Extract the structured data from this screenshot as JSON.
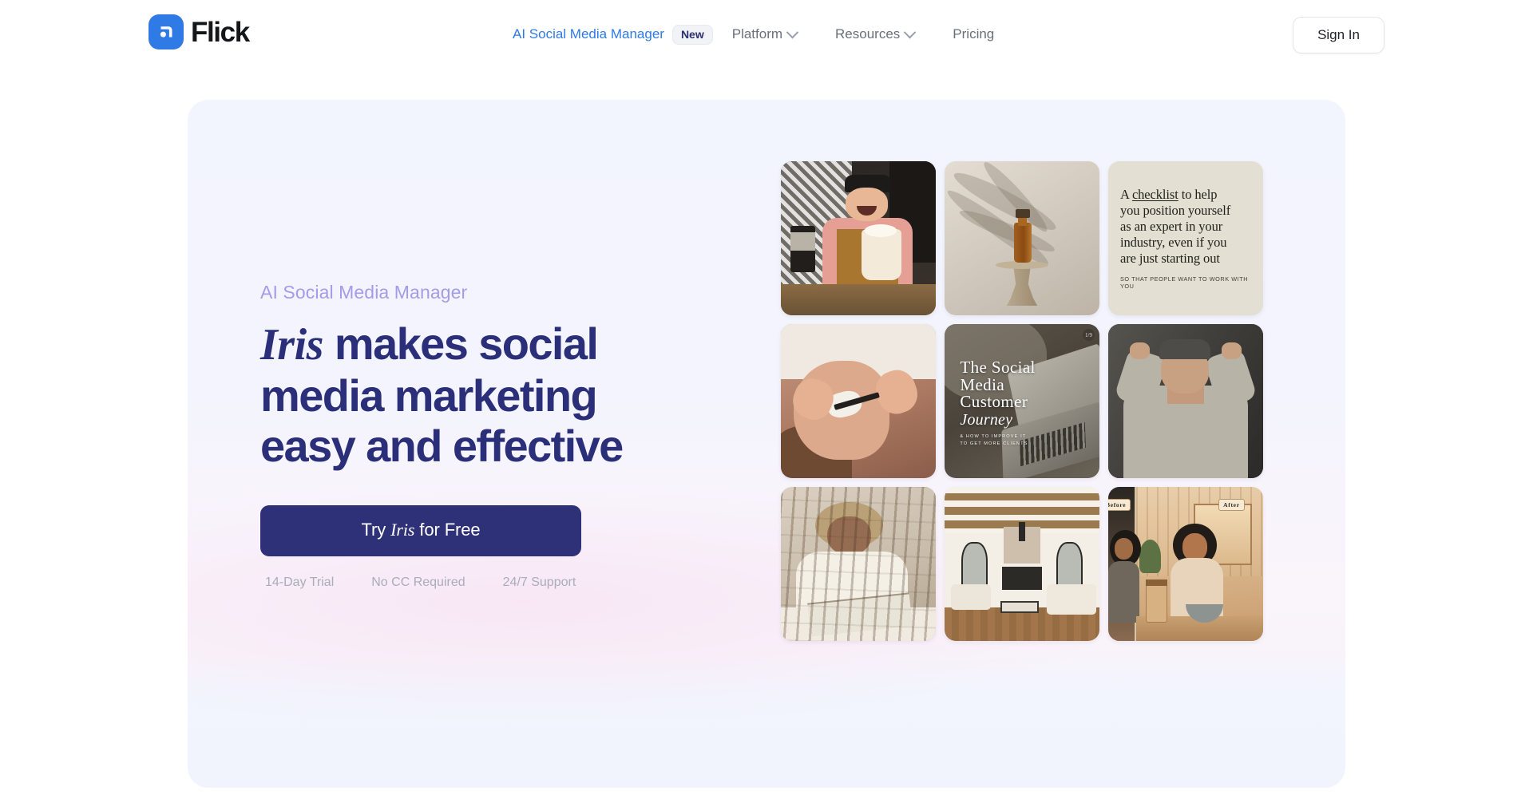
{
  "header": {
    "brand": {
      "name": "Flick",
      "mark_color": "#2f7ae5",
      "icon": "flick-logo-icon"
    },
    "nav": [
      {
        "label": "AI Social Media Manager",
        "badge": "New",
        "featured": true,
        "has_dropdown": false
      },
      {
        "label": "Platform",
        "badge": null,
        "featured": false,
        "has_dropdown": true
      },
      {
        "label": "Resources",
        "badge": null,
        "featured": false,
        "has_dropdown": true
      },
      {
        "label": "Pricing",
        "badge": null,
        "featured": false,
        "has_dropdown": false
      }
    ],
    "signin_label": "Sign In"
  },
  "hero": {
    "eyebrow": "AI Social Media Manager",
    "headline": {
      "brand_word": "Iris",
      "rest_line1": " makes social",
      "line2": "media marketing",
      "line3": "easy and effective",
      "color": "#2b2f79"
    },
    "cta": {
      "prefix": "Try ",
      "brand_word": "Iris",
      "suffix": " for Free",
      "background": "#2f3178",
      "text_color": "#ffffff"
    },
    "trust": [
      "14-Day Trial",
      "No CC Required",
      "24/7 Support"
    ],
    "panel_background": "#f3f5fe"
  },
  "media_grid": {
    "cards": [
      {
        "id": "card-barista",
        "alt": "Smiling barista in apron holding a milkshake"
      },
      {
        "id": "card-dropper-bottle",
        "alt": "Amber dropper bottle on a wooden pedestal with palm shadows"
      },
      {
        "id": "card-checklist-quote",
        "quote_line1_a": "A ",
        "quote_line1_underline": "checklist",
        "quote_line1_b": " to help",
        "quote_line2": "you position yourself",
        "quote_line3": "as an expert in your",
        "quote_line4": "industry, even if you",
        "quote_line5": "are just starting out",
        "quote_sub": "So that people want to work with you",
        "background": "#e3dfd2"
      },
      {
        "id": "card-lash-treatment",
        "alt": "Beauty technician applying lash treatment to a reclining client"
      },
      {
        "id": "card-journey-cover",
        "title_line1": "The Social",
        "title_line2": "Media",
        "title_line3": "Customer",
        "title_script": "Journey",
        "subtitle_line1": "& how to improve it",
        "subtitle_line2": "to get more clients",
        "corner_badge": "1/9"
      },
      {
        "id": "card-stretching-man",
        "alt": "Man in beanie and sweatshirt stretching his arms overhead"
      },
      {
        "id": "card-woman-reading",
        "alt": "Woman with curly hair reading in a rattan chair"
      },
      {
        "id": "card-living-room",
        "alt": "Bright living room interior with exposed beams and fireplace"
      },
      {
        "id": "card-before-after",
        "label_before": "Before",
        "label_after": "After",
        "alt": "Illustrated before and after of a woman eating a healthy meal"
      }
    ]
  }
}
